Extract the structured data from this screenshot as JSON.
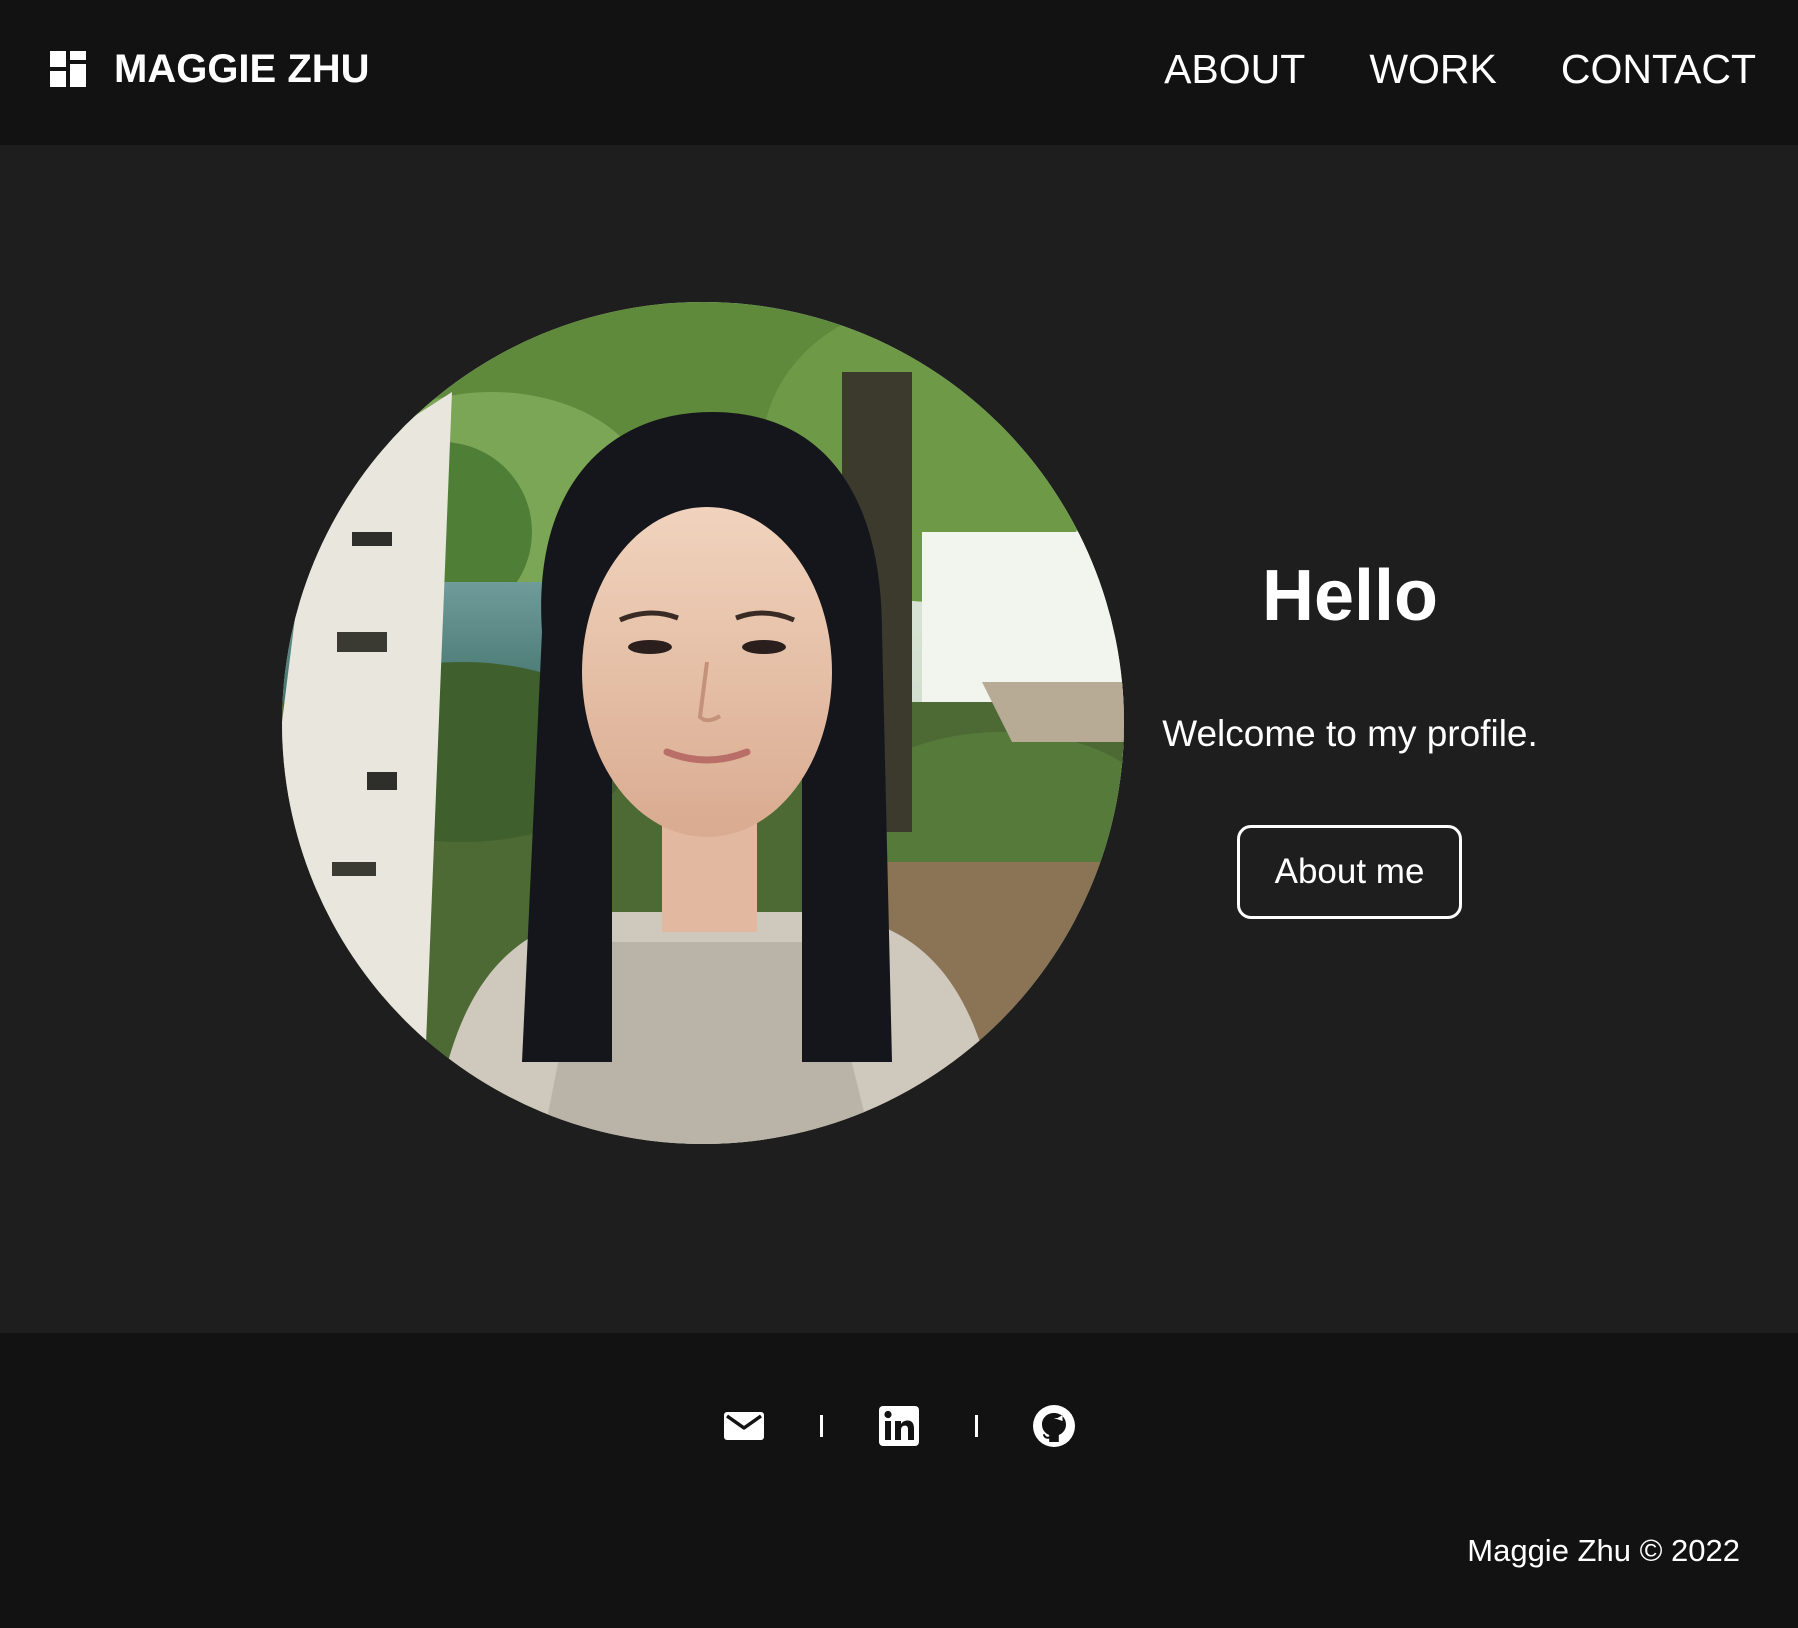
{
  "header": {
    "brand_name": "MAGGIE ZHU",
    "brand_icon": "grid-logo-icon",
    "nav": [
      {
        "label": "ABOUT"
      },
      {
        "label": "WORK"
      },
      {
        "label": "CONTACT"
      }
    ]
  },
  "hero": {
    "portrait_alt": "portrait-photo",
    "title": "Hello",
    "subtitle": "Welcome to my profile.",
    "cta_label": "About me"
  },
  "footer": {
    "socials": [
      {
        "icon": "mail-icon"
      },
      {
        "icon": "linkedin-icon"
      },
      {
        "icon": "github-icon"
      }
    ],
    "separator": "|",
    "copyright": "Maggie Zhu © 2022"
  },
  "colors": {
    "header_bg": "#121212",
    "page_bg": "#1e1e1e",
    "text": "#ffffff"
  }
}
